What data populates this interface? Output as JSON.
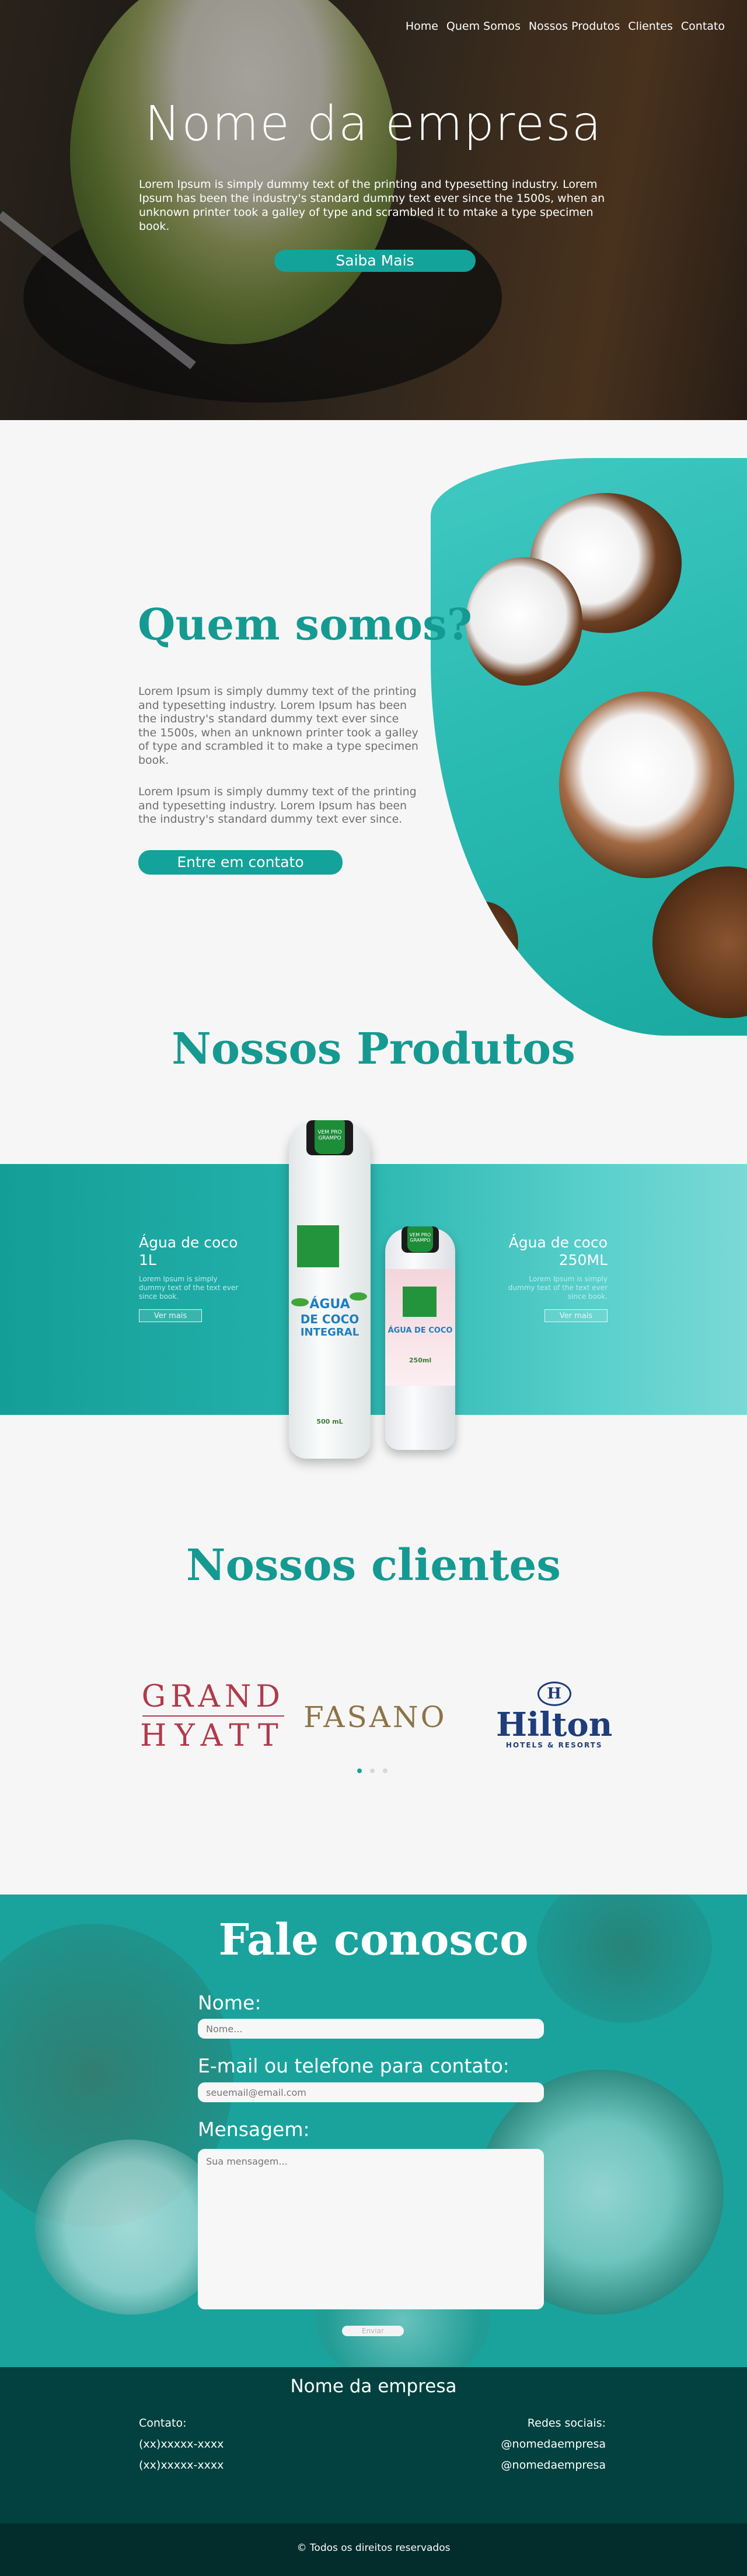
{
  "nav": {
    "items": [
      "Home",
      "Quem Somos",
      "Nossos Produtos",
      "Clientes",
      "Contato"
    ]
  },
  "hero": {
    "title": "Nome da empresa",
    "text": "Lorem Ipsum is simply dummy text of the printing and typesetting industry. Lorem Ipsum has been the industry's standard dummy text ever since the 1500s, when an unknown printer took a galley of type and scrambled it to mtake a type specimen book.",
    "button": "Saiba Mais"
  },
  "about": {
    "title": "Quem somos?",
    "paragraph1": "Lorem Ipsum is simply dummy text of the printing and typesetting industry. Lorem Ipsum has been the industry's standard dummy text ever since the 1500s, when an unknown printer took a galley of type and scrambled it to make a type specimen book.",
    "paragraph2": "Lorem Ipsum is simply dummy text of the printing and typesetting industry. Lorem Ipsum has been the industry's standard dummy text ever since.",
    "button": "Entre em contato"
  },
  "products": {
    "title": "Nossos Produtos",
    "left": {
      "name": "Água de coco 1L",
      "desc": "Lorem Ipsum is simply dummy text of the text ever since book.",
      "more": "Ver mais"
    },
    "right": {
      "name": "Água de coco 250ML",
      "desc": "Lorem Ipsum is simply dummy text of the text ever since book.",
      "more": "Ver mais"
    },
    "bottle_big": {
      "cap_tag": "VEM PRO GRAMPO",
      "label_line1": "ÁGUA",
      "label_line2": "DE COCO",
      "label_line3": "INTEGRAL",
      "volume": "500 mL"
    },
    "bottle_small": {
      "cap_tag": "VEM PRO GRAMPO",
      "label_line1": "ÁGUA DE COCO",
      "volume": "250ml"
    }
  },
  "clients": {
    "title": "Nossos clientes",
    "hyatt_line1": "GRAND",
    "hyatt_line2": "HYATT",
    "fasano": "FASANO",
    "hilton_emblem": "H",
    "hilton_word": "Hilton",
    "hilton_sub": "HOTELS & RESORTS"
  },
  "contact": {
    "title": "Fale conosco",
    "name_label": "Nome:",
    "name_placeholder": "Nome...",
    "email_label": "E-mail ou telefone para contato:",
    "email_placeholder": "seuemail@email.com",
    "message_label": "Mensagem:",
    "message_placeholder": "Sua mensagem...",
    "send": "Enviar"
  },
  "footer": {
    "company": "Nome da empresa",
    "contact_label": "Contato:",
    "phone1": "(xx)xxxxx-xxxx",
    "phone2": "(xx)xxxxx-xxxx",
    "social_label": "Redes sociais:",
    "social1": "@nomedaempresa",
    "social2": "@nomedaempresa",
    "copyright": "© Todos os direitos reservados"
  },
  "colors": {
    "accent": "#159a92",
    "button": "#13a39a",
    "footer": "#02413f"
  }
}
